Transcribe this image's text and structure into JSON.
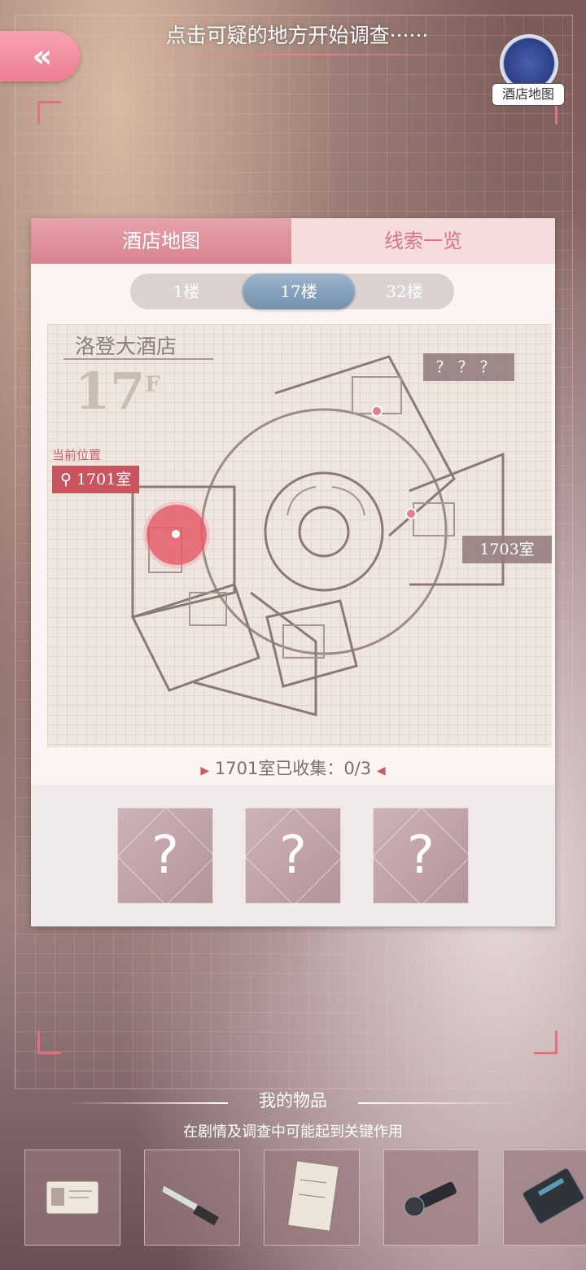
{
  "header": {
    "back_label": "«",
    "instruction": "点击可疑的地方开始调查······",
    "map_button": "酒店地图"
  },
  "panel": {
    "tabs": [
      {
        "label": "酒店地图",
        "active": true
      },
      {
        "label": "线索一览",
        "active": false
      }
    ],
    "floors": [
      {
        "label": "1楼",
        "active": false
      },
      {
        "label": "17楼",
        "active": true
      },
      {
        "label": "32楼",
        "active": false
      }
    ],
    "map": {
      "hotel_name": "洛登大酒店",
      "floor_number": "17",
      "floor_suffix": "F",
      "current_position_label": "当前位置",
      "current_room": "1701室",
      "rooms": [
        "？？？",
        "1703室"
      ]
    },
    "collected_text": "1701室已收集：0/3",
    "clues": [
      "?",
      "?",
      "?"
    ]
  },
  "items": {
    "title": "我的物品",
    "subtitle": "在剧情及调查中可能起到关键作用",
    "list": [
      "id-card-icon",
      "knife-icon",
      "hotel-booklet-icon",
      "flashlight-icon",
      "keycard-icon"
    ]
  },
  "colors": {
    "accent": "#ee7e91",
    "room_pin": "#c9545f",
    "floor_active": "#7390ad"
  }
}
